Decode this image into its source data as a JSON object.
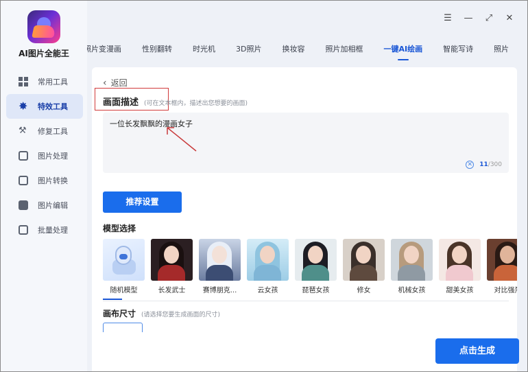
{
  "app": {
    "name": "AI图片全能王"
  },
  "sidebar": {
    "items": [
      {
        "label": "常用工具",
        "icon": "grid-icon"
      },
      {
        "label": "特效工具",
        "icon": "star-icon",
        "active": true
      },
      {
        "label": "修复工具",
        "icon": "magic-wand-icon"
      },
      {
        "label": "图片处理",
        "icon": "image-icon"
      },
      {
        "label": "图片转换",
        "icon": "convert-icon"
      },
      {
        "label": "图片编辑",
        "icon": "edit-icon"
      },
      {
        "label": "批量处理",
        "icon": "upload-icon"
      }
    ]
  },
  "window": {
    "menu": "☰",
    "minimize": "—",
    "maximize": "⤢",
    "close": "✕"
  },
  "tabs": [
    {
      "label": "照片变漫画"
    },
    {
      "label": "性别翻转"
    },
    {
      "label": "时光机"
    },
    {
      "label": "3D照片"
    },
    {
      "label": "换妆容"
    },
    {
      "label": "照片加相框"
    },
    {
      "label": "一键AI绘画",
      "active": true
    },
    {
      "label": "智能写诗"
    },
    {
      "label": "照片"
    }
  ],
  "main": {
    "back_label": "返回",
    "desc_title": "画面描述",
    "desc_hint": "(可在文本框内，描述出您想要的画面)",
    "desc_value": "一位长发飘飘的漫画女子",
    "counter_current": "11",
    "counter_max": "/300",
    "recommend_label": "推荐设置",
    "model_title": "模型选择",
    "models": [
      {
        "name": "随机模型"
      },
      {
        "name": "长发武士"
      },
      {
        "name": "赛博朋克..."
      },
      {
        "name": "云女孩"
      },
      {
        "name": "琵琶女孩"
      },
      {
        "name": "修女"
      },
      {
        "name": "机械女孩"
      },
      {
        "name": "甜美女孩"
      },
      {
        "name": "对比强烈"
      }
    ],
    "canvas_title": "画布尺寸",
    "canvas_hint": "(请选择您要生成画面的尺寸)",
    "generate_label": "点击生成"
  },
  "colors": {
    "accent": "#1a6dec",
    "highlight_box": "#d0393a"
  }
}
